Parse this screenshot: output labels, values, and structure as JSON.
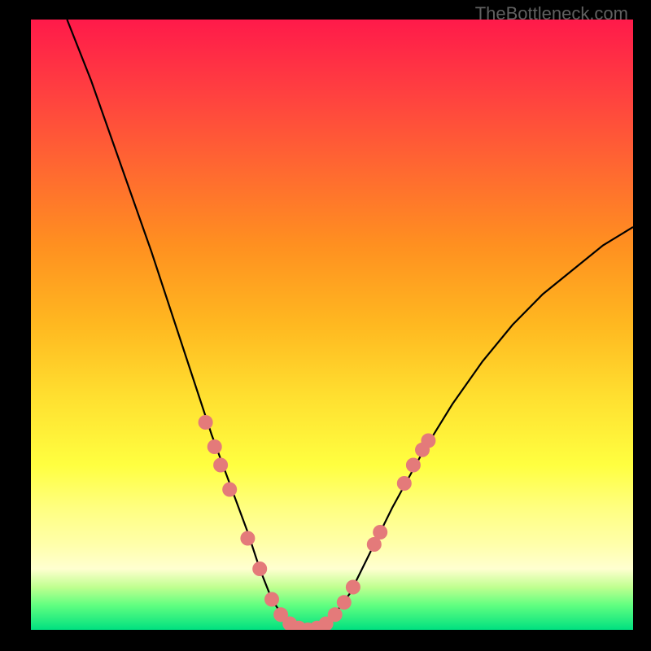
{
  "attribution": "TheBottleneck.com",
  "chart_data": {
    "type": "line",
    "title": "",
    "xlabel": "",
    "ylabel": "",
    "xlim": [
      0,
      100
    ],
    "ylim": [
      0,
      100
    ],
    "series": [
      {
        "name": "bottleneck-curve",
        "x": [
          6,
          10,
          15,
          20,
          25,
          28,
          30,
          33,
          36,
          38,
          40,
          42,
          44,
          46,
          48,
          50,
          53,
          56,
          60,
          65,
          70,
          75,
          80,
          85,
          90,
          95,
          100
        ],
        "y": [
          100,
          90,
          76,
          62,
          47,
          38,
          32,
          24,
          16,
          10,
          5,
          2,
          0.5,
          0,
          0.5,
          2,
          6,
          12,
          20,
          29,
          37,
          44,
          50,
          55,
          59,
          63,
          66
        ]
      }
    ],
    "markers": {
      "name": "sample-points",
      "color": "#e47a7a",
      "points": [
        {
          "x": 29,
          "y": 34
        },
        {
          "x": 30.5,
          "y": 30
        },
        {
          "x": 31.5,
          "y": 27
        },
        {
          "x": 33,
          "y": 23
        },
        {
          "x": 36,
          "y": 15
        },
        {
          "x": 38,
          "y": 10
        },
        {
          "x": 40,
          "y": 5
        },
        {
          "x": 41.5,
          "y": 2.5
        },
        {
          "x": 43,
          "y": 1
        },
        {
          "x": 44.5,
          "y": 0.3
        },
        {
          "x": 46,
          "y": 0
        },
        {
          "x": 47.5,
          "y": 0.3
        },
        {
          "x": 49,
          "y": 1
        },
        {
          "x": 50.5,
          "y": 2.5
        },
        {
          "x": 52,
          "y": 4.5
        },
        {
          "x": 53.5,
          "y": 7
        },
        {
          "x": 57,
          "y": 14
        },
        {
          "x": 58,
          "y": 16
        },
        {
          "x": 62,
          "y": 24
        },
        {
          "x": 63.5,
          "y": 27
        },
        {
          "x": 65,
          "y": 29.5
        },
        {
          "x": 66,
          "y": 31
        }
      ]
    },
    "background_gradient": {
      "top": "#ff1a4a",
      "middle": "#ffff40",
      "bottom": "#00e080"
    }
  }
}
